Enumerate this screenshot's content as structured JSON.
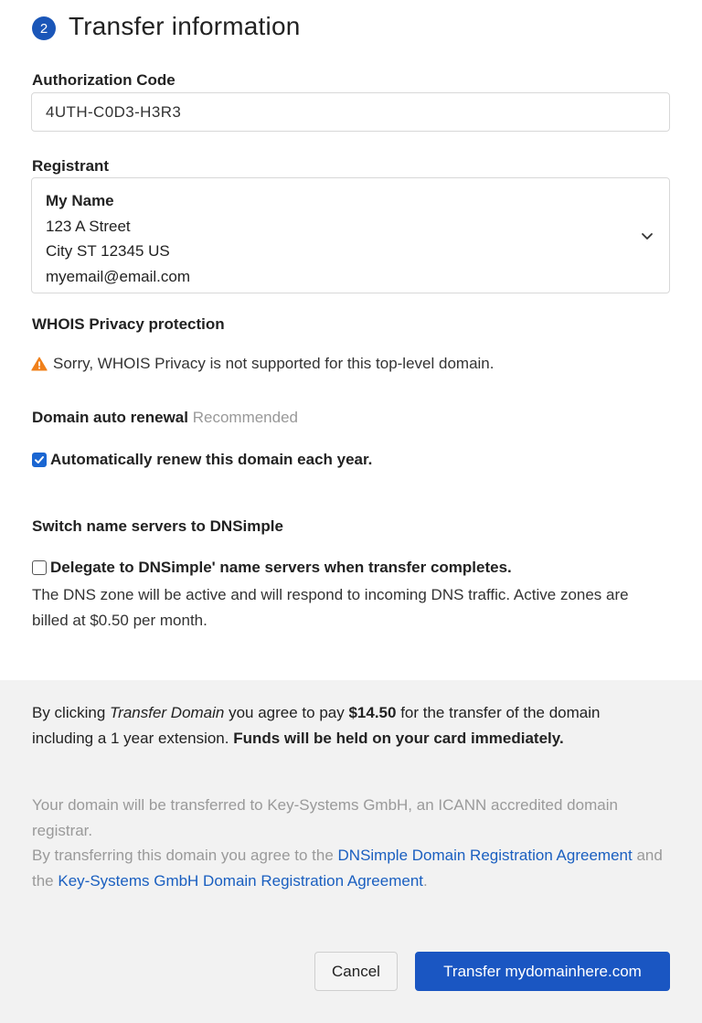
{
  "header": {
    "step_number": "2",
    "title": "Transfer information"
  },
  "auth": {
    "label": "Authorization Code",
    "value": "4UTH-C0D3-H3R3"
  },
  "registrant": {
    "label": "Registrant",
    "name": "My Name",
    "street": "123 A Street",
    "city_line": "City ST 12345 US",
    "email": "myemail@email.com"
  },
  "whois": {
    "label": "WHOIS Privacy protection",
    "warning": "Sorry, WHOIS Privacy is not supported for this top-level domain."
  },
  "auto_renew": {
    "label": "Domain auto renewal",
    "hint": "Recommended",
    "checkbox_label": "Automatically renew this domain each year.",
    "checked": true
  },
  "name_servers": {
    "label": "Switch name servers to DNSimple",
    "checkbox_label": "Delegate to DNSimple' name servers when transfer completes.",
    "checked": false,
    "description": "The DNS zone will be active and will respond to incoming DNS traffic. Active zones are billed at $0.50 per month."
  },
  "footer": {
    "agree_prefix": "By clicking ",
    "agree_action": "Transfer Domain",
    "agree_middle": " you agree to pay ",
    "agree_price": "$14.50",
    "agree_suffix": " for the transfer of the domain including a 1 year extension. ",
    "agree_bold": "Funds will be held on your card immediately.",
    "legal_line1": "Your domain will be transferred to Key-Systems GmbH, an ICANN accredited domain registrar.",
    "legal_prefix": "By transferring this domain you agree to the ",
    "link1": "DNSimple Domain Registration Agreement",
    "legal_and": " and the ",
    "link2": "Key-Systems GmbH Domain Registration Agreement",
    "legal_end": "."
  },
  "buttons": {
    "cancel": "Cancel",
    "submit": "Transfer mydomainhere.com"
  },
  "colors": {
    "accent": "#1a56c2",
    "warning": "#f0801a",
    "footer_bg": "#f2f2f2"
  }
}
